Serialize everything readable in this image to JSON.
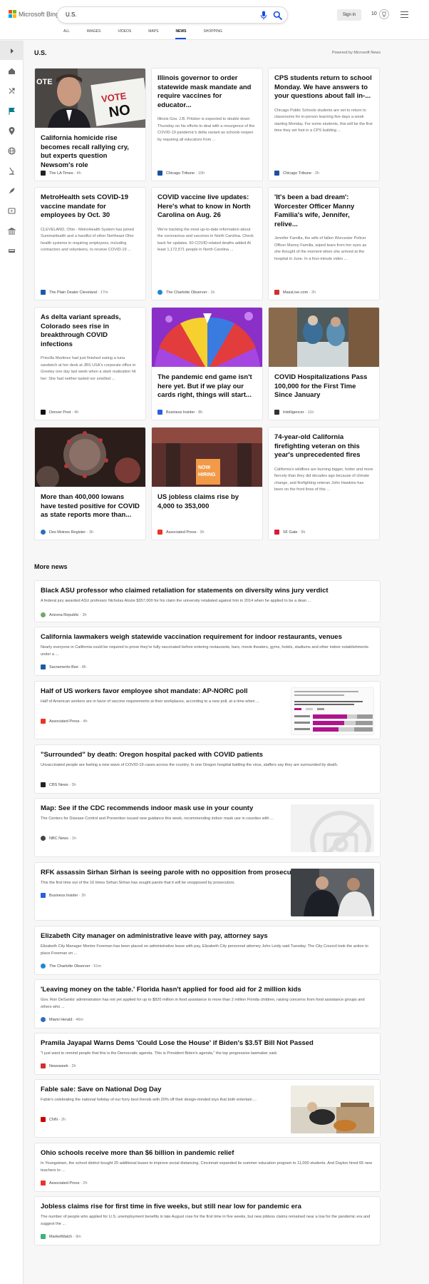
{
  "header": {
    "logo_text": "Microsoft Bing",
    "search_value": "U.S.",
    "signin_label": "Sign in",
    "points": "10"
  },
  "tabs": [
    "ALL",
    "IMAGES",
    "VIDEOS",
    "MAPS",
    "NEWS",
    "SHOPPING"
  ],
  "active_tab": "NEWS",
  "section": {
    "title": "U.S.",
    "powered": "Powered by Microsoft News"
  },
  "cards": [
    {
      "title": "California homicide rise becomes recall rallying cry, but experts question Newsom's role",
      "desc": "",
      "source": "The LA Times",
      "time": "4h",
      "image": "photo-newsom"
    },
    {
      "title": "Illinois governor to order statewide mask mandate and require vaccines for educator...",
      "desc": "Illinois Gov. J.B. Pritzker is expected to double down Thursday on his efforts to deal with a resurgence of the COVID-19 pandemic's delta variant as schools reopen by requiring all educators from ...",
      "source": "Chicago Tribune",
      "time": "10h",
      "image": ""
    },
    {
      "title": "CPS students return to school Monday. We have answers to your questions about fall in-...",
      "desc": "Chicago Public Schools students are set to return to classrooms for in-person learning five days a week starting Monday. For some students, this will be the first time they set foot in a CPS building ...",
      "source": "Chicago Tribune",
      "time": "2h",
      "image": ""
    },
    {
      "title": "MetroHealth sets COVID-19 vaccine mandate for employees by Oct. 30",
      "desc": "CLEVELAND, Ohio - MetroHealth System has joined SummaHealth and a handful of other Northeast Ohio health systems in requiring employees, including contractors and volunteers, to receive COVID-19 ...",
      "source": "The Plain Dealer Cleveland",
      "time": "17m",
      "image": ""
    },
    {
      "title": "COVID vaccine live updates: Here's what to know in North Carolina on Aug. 26",
      "desc": "We're tracking the most up-to-date information about the coronavirus and vaccines in North Carolina. Check back for updates. 60 COVID-related deaths added At least 1,172,571 people in North Carolina ...",
      "source": "The Charlotte Observer",
      "time": "1h",
      "image": ""
    },
    {
      "title": "'It's been a bad dream': Worcester Officer Manny Familia's wife, Jennifer, relive...",
      "desc": "Jennifer Familia, the wife of fallen Worcester Policer Officer Manny Familia, wiped tears from her eyes as she thought of the moment when she arrived at the hospital in June. In a four-minute video ...",
      "source": "MassLive.com",
      "time": "2h",
      "image": ""
    },
    {
      "title": "As delta variant spreads, Colorado sees rise in breakthrough COVID infections",
      "desc": "Priscilla Martinez had just finished eating a tuna sandwich at her desk at JBS USA's corporate office in Greeley one day last week when a stark realization hit her: She had neither tasted nor smelled ...",
      "source": "Denver Post",
      "time": "4h",
      "image": ""
    },
    {
      "title": "The pandemic end game isn't here yet. But if we play our cards right, things will start...",
      "desc": "",
      "source": "Business Insider",
      "time": "8h",
      "image": "photo-wheel"
    },
    {
      "title": "COVID Hospitalizations Pass 100,000 for the First Time Since January",
      "desc": "",
      "source": "Intelligencer",
      "time": "11h",
      "image": "photo-hospital"
    },
    {
      "title": "More than 400,000 Iowans have tested positive for COVID as state reports more than...",
      "desc": "",
      "source": "Des Moines Register",
      "time": "3h",
      "image": "photo-virus"
    },
    {
      "title": "US jobless claims rise by 4,000 to 353,000",
      "desc": "",
      "source": "Associated Press",
      "time": "3h",
      "image": "photo-hiring"
    },
    {
      "title": "74-year-old California firefighting veteran on this year's unprecedented fires",
      "desc": "California's wildfires are burning bigger, hotter and more fiercely than they did decades ago because of climate change, and firefighting veteran John Hawkins has been on the front lines of this ...",
      "source": "SF Gate",
      "time": "5h",
      "image": ""
    }
  ],
  "more_news": {
    "title": "More news",
    "items": [
      {
        "title": "Black ASU professor who claimed retaliation for statements on diversity wins jury verdict",
        "desc": "A federal jury awarded ASU professor Nicholas Alozie $357,000 for his claim the university retaliated against him in 2014 when he applied to be a dean ...",
        "source": "Arizona Republic",
        "time": "3h",
        "image": ""
      },
      {
        "title": "California lawmakers weigh statewide vaccination requirement for indoor restaurants, venues",
        "desc": "Nearly everyone in California could be required to prove they're fully vaccinated before entering restaurants, bars, movie theaters, gyms, hotels, stadiums and other indoor establishments under a ...",
        "source": "Sacramento Bee",
        "time": "8h",
        "image": ""
      },
      {
        "title": "Half of US workers favor employee shot mandate: AP-NORC poll",
        "desc": "Half of American workers are in favor of vaccine requirements at their workplaces, according to a new poll, at a time when ...",
        "source": "Associated Press",
        "time": "4h",
        "image": "poll-chart"
      },
      {
        "title": "\"Surrounded\" by death: Oregon hospital packed with COVID patients",
        "desc": "Unvaccinated people are fueling a new wave of COVID-19 cases across the country. In one Oregon hospital battling the virus, staffers say they are surrounded by death.",
        "source": "CBS News",
        "time": "3h",
        "image": ""
      },
      {
        "title": "Map: See if the CDC recommends indoor mask use in your county",
        "desc": "The Centers for Disease Control and Prevention issued new guidance this week, recommending indoor mask use in counties with ...",
        "source": "NBC News",
        "time": "1h",
        "image": "no-image"
      },
      {
        "title": "RFK assassin Sirhan Sirhan is seeing parole with no opposition from prosecutors",
        "desc": "This the first time out of the 16 times Sirhan Sirhan has sought parole that it will be unopposed by prosecutors.",
        "source": "Business Insider",
        "time": "2h",
        "image": "photo-sirhan"
      },
      {
        "title": "Elizabeth City manager on administrative leave with pay, attorney says",
        "desc": "Elizabeth City Manager Montre Freeman has been placed on administrative leave with pay, Elizabeth City personnel attorney John Leidy said Tuesday. The City Council took the action to place Freeman on ...",
        "source": "The Charlotte Observer",
        "time": "51m",
        "image": ""
      },
      {
        "title": "'Leaving money on the table.' Florida hasn't applied for food aid for 2 million kids",
        "desc": "Gov. Ron DeSantis' administration has not yet applied for up to $820 million in food assistance to more than 2 million Florida children, raising concerns from food assistance groups and others who ...",
        "source": "Miami Herald",
        "time": "46m",
        "image": ""
      },
      {
        "title": "Pramila Jayapal Warns Dems 'Could Lose the House' if Biden's $3.5T Bill Not Passed",
        "desc": "\"I just want to remind people that this is the Democratic agenda. This is President Biden's agenda,\" the top progressive lawmaker said.",
        "source": "Newsweek",
        "time": "2h",
        "image": ""
      },
      {
        "title": "Fable sale: Save on National Dog Day",
        "desc": "Fable's celebrating the national holiday of our furry best friends with 20% off their design-minded toys that both entertain ...",
        "source": "CNN",
        "time": "2h",
        "image": "photo-dog"
      },
      {
        "title": "Ohio schools receive more than $6 billion in pandemic relief",
        "desc": "In Youngstown, the school district bought 20 additional buses to improve social distancing. Cincinnati expanded its summer education program to 11,000 students. And Dayton hired 65 new teachers to ...",
        "source": "Associated Press",
        "time": "2h",
        "image": ""
      },
      {
        "title": "Jobless claims rise for first time in five weeks, but still near low for pandemic era",
        "desc": "The number of people who applied for U.S. unemployment benefits in late August rose for the first time in five weeks, but new jobless claims remained near a low for the pandemic era and suggest the ...",
        "source": "MarketWatch",
        "time": "9m",
        "image": ""
      }
    ]
  },
  "colors": {
    "accent": "#174ae4",
    "nav_flag": "#0a7d89",
    "logo": [
      "#f25022",
      "#7fba00",
      "#00a4ef",
      "#ffb900"
    ]
  }
}
